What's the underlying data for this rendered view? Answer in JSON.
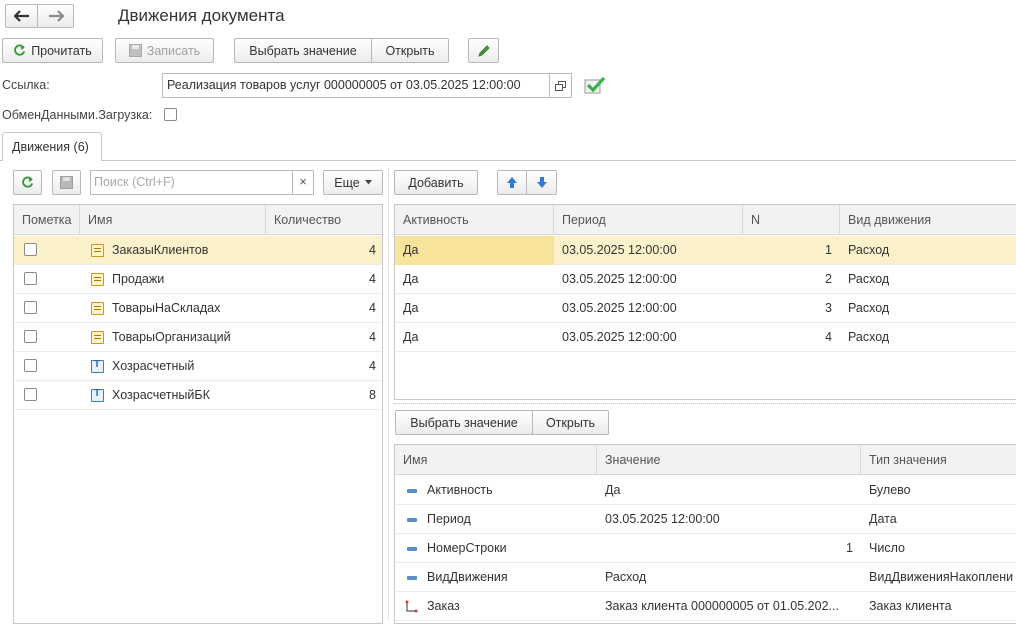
{
  "title": "Движения документа",
  "toolbar": {
    "read": "Прочитать",
    "write": "Записать",
    "select_value": "Выбрать значение",
    "open": "Открыть"
  },
  "ref": {
    "label": "Ссылка:",
    "value": "Реализация товаров услуг 000000005 от 03.05.2025 12:00:00"
  },
  "exchange": {
    "label": "ОбменДанными.Загрузка:"
  },
  "tab": {
    "label": "Движения (6)"
  },
  "left_toolbar": {
    "search_placeholder": "Поиск (Ctrl+F)",
    "clear": "×",
    "more": "Еще"
  },
  "left_table": {
    "columns": [
      "Пометка",
      "Имя",
      "Количество"
    ],
    "rows": [
      {
        "name": "ЗаказыКлиентов",
        "count": "4",
        "icon": "register-icon"
      },
      {
        "name": "Продажи",
        "count": "4",
        "icon": "register-icon"
      },
      {
        "name": "ТоварыНаСкладах",
        "count": "4",
        "icon": "register-icon"
      },
      {
        "name": "ТоварыОрганизаций",
        "count": "4",
        "icon": "register-icon"
      },
      {
        "name": "Хозрасчетный",
        "count": "4",
        "icon": "accounting-register-icon"
      },
      {
        "name": "ХозрасчетныйБК",
        "count": "8",
        "icon": "accounting-register-icon"
      }
    ]
  },
  "right_toolbar": {
    "add": "Добавить"
  },
  "movements_table": {
    "columns": [
      "Активность",
      "Период",
      "N",
      "Вид движения"
    ],
    "rows": [
      {
        "active": "Да",
        "period": "03.05.2025 12:00:00",
        "n": "1",
        "kind": "Расход"
      },
      {
        "active": "Да",
        "period": "03.05.2025 12:00:00",
        "n": "2",
        "kind": "Расход"
      },
      {
        "active": "Да",
        "period": "03.05.2025 12:00:00",
        "n": "3",
        "kind": "Расход"
      },
      {
        "active": "Да",
        "period": "03.05.2025 12:00:00",
        "n": "4",
        "kind": "Расход"
      }
    ]
  },
  "details_toolbar": {
    "select_value": "Выбрать значение",
    "open": "Открыть"
  },
  "details_table": {
    "columns": [
      "Имя",
      "Значение",
      "Тип значения"
    ],
    "rows": [
      {
        "name": "Активность",
        "value": "Да",
        "type": "Булево",
        "icon": "field-icon"
      },
      {
        "name": "Период",
        "value": "03.05.2025 12:00:00",
        "type": "Дата",
        "icon": "field-icon"
      },
      {
        "name": "НомерСтроки",
        "value": "1",
        "type": "Число",
        "icon": "field-icon"
      },
      {
        "name": "ВидДвижения",
        "value": "Расход",
        "type": "ВидДвиженияНакоплени",
        "icon": "field-icon"
      },
      {
        "name": "Заказ",
        "value": "Заказ клиента 000000005 от 01.05.202...",
        "type": "Заказ клиента",
        "icon": "dimension-icon"
      }
    ]
  },
  "colors": {
    "selected_row": "#fbf2cc",
    "active_cell": "#f7e39a",
    "accent_green": "#3a9a3a",
    "accent_blue": "#2e7bd6"
  }
}
